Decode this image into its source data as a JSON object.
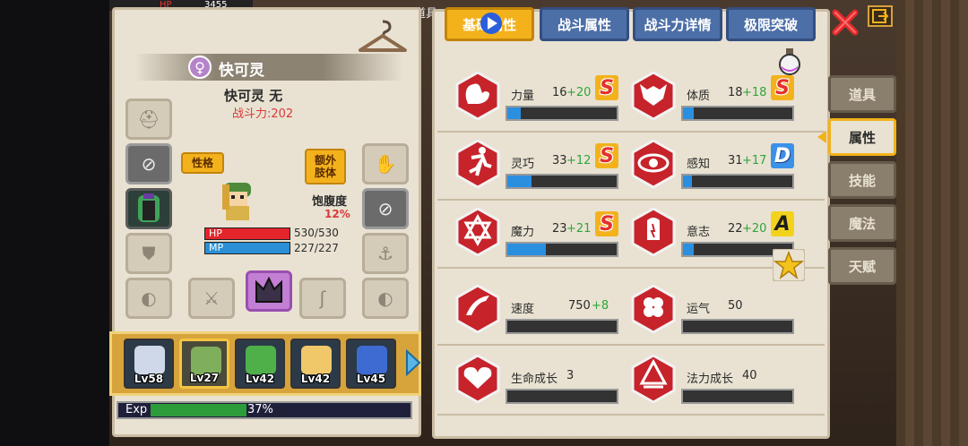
{
  "hud": {
    "hp_label": "HP",
    "hp_value": "3455",
    "top_text": "道具"
  },
  "character": {
    "name": "快可灵",
    "gender_symbol": "♀",
    "subtitle": "快可灵 无",
    "power_label": "战斗力:202",
    "personality_button": "性格",
    "extra_limb_button": "额外肢体",
    "hunger_label": "饱腹度",
    "hunger_value": "12%",
    "hp_label": "HP",
    "hp_value": "530/530",
    "hp_fraction": 1.0,
    "mp_label": "MP",
    "mp_value": "227/227",
    "mp_fraction": 1.0
  },
  "team": [
    {
      "level": "Lv58",
      "selected": false,
      "color": "#cfd8e8"
    },
    {
      "level": "Lv27",
      "selected": true,
      "color": "#7fae5c"
    },
    {
      "level": "Lv42",
      "selected": false,
      "color": "#4fb04a"
    },
    {
      "level": "Lv42",
      "selected": false,
      "color": "#f0c86a"
    },
    {
      "level": "Lv45",
      "selected": false,
      "color": "#3d6bd1"
    }
  ],
  "exp": {
    "label": "Exp",
    "value": "37%",
    "fraction": 0.37
  },
  "tabs": [
    {
      "label": "基础属性",
      "active": true
    },
    {
      "label": "战斗属性",
      "active": false
    },
    {
      "label": "战斗力详情",
      "active": false
    },
    {
      "label": "极限突破",
      "active": false
    }
  ],
  "stats": [
    {
      "label": "力量",
      "base": "16",
      "bonus": "+20",
      "grade": "S",
      "fill": 0.12,
      "icon": "muscle-icon"
    },
    {
      "label": "体质",
      "base": "18",
      "bonus": "+18",
      "grade": "S",
      "fill": 0.1,
      "icon": "body-icon"
    },
    {
      "label": "灵巧",
      "base": "33",
      "bonus": "+12",
      "grade": "S",
      "fill": 0.22,
      "icon": "running-icon"
    },
    {
      "label": "感知",
      "base": "31",
      "bonus": "+17",
      "grade": "D",
      "fill": 0.08,
      "icon": "eye-icon"
    },
    {
      "label": "魔力",
      "base": "23",
      "bonus": "+21",
      "grade": "S",
      "fill": 0.35,
      "icon": "hexagram-icon"
    },
    {
      "label": "意志",
      "base": "22",
      "bonus": "+20",
      "grade": "A",
      "fill": 0.1,
      "icon": "will-icon"
    },
    {
      "label": "速度",
      "base": "750",
      "bonus": "+8",
      "grade": "",
      "fill": 0,
      "icon": "speed-icon"
    },
    {
      "label": "运气",
      "base": "50",
      "bonus": "",
      "grade": "",
      "fill": 0,
      "icon": "clover-icon"
    },
    {
      "label": "生命成长",
      "base": "3",
      "bonus": "",
      "grade": "",
      "fill": 0,
      "icon": "heart-icon"
    },
    {
      "label": "法力成长",
      "base": "40",
      "bonus": "",
      "grade": "",
      "fill": 0,
      "icon": "magic-growth-icon"
    }
  ],
  "side_menu": [
    {
      "label": "道具",
      "active": false
    },
    {
      "label": "属性",
      "active": true
    },
    {
      "label": "技能",
      "active": false
    },
    {
      "label": "魔法",
      "active": false
    },
    {
      "label": "天赋",
      "active": false
    }
  ],
  "colors": {
    "accent": "#f3b21c",
    "tab_blue": "#4c6fa8",
    "stat_icon_red": "#c7232a",
    "bonus_green": "#2fa53a"
  }
}
